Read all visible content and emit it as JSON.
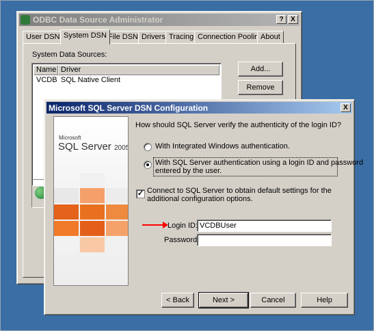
{
  "odbc": {
    "title": "ODBC Data Source Administrator",
    "help_btn": "?",
    "close_btn": "X",
    "tabs": [
      "User DSN",
      "System DSN",
      "File DSN",
      "Drivers",
      "Tracing",
      "Connection Pooling",
      "About"
    ],
    "list_label": "System Data Sources:",
    "columns": [
      "Name",
      "Driver"
    ],
    "rows": [
      {
        "name": "VCDB",
        "driver": "SQL Native Client"
      }
    ],
    "add_btn": "Add...",
    "remove_btn": "Remove"
  },
  "dsn": {
    "title": "Microsoft SQL Server DSN Configuration",
    "close_btn": "X",
    "logo": {
      "brand": "Microsoft",
      "product": "SQL Server",
      "year": "2005"
    },
    "question": "How should SQL Server verify the authenticity of the login ID?",
    "radio_windows": "With Integrated Windows authentication.",
    "radio_sql_line1": "With SQL Server authentication using a login ID and password",
    "radio_sql_line2": "entered by the user.",
    "connect_line1": "Connect to SQL Server to obtain default settings for the",
    "connect_line2": "additional configuration options.",
    "connect_checked": true,
    "auth_mode": "sql",
    "login_label": "Login ID:",
    "login_value": "VCDBUser",
    "password_label": "Password:",
    "password_value": "",
    "back_btn": "< Back",
    "next_btn": "Next >",
    "cancel_btn": "Cancel",
    "help_btn": "Help",
    "arrow_color": "#ff0000",
    "title_gradient": [
      "#0a246a",
      "#a6caf0"
    ]
  }
}
